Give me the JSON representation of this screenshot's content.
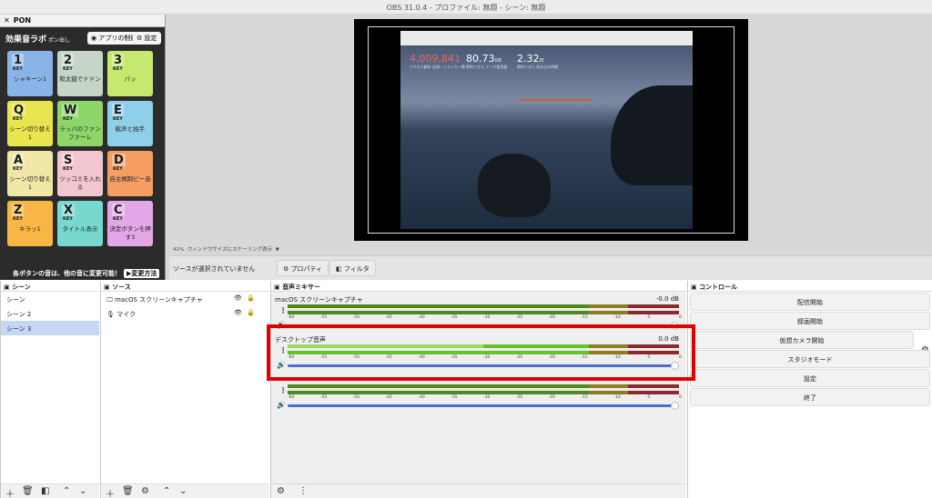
{
  "window": {
    "title": "OBS 31.0.4 - プロファイル: 無題 - シーン: 無題"
  },
  "pon": {
    "close": "✕",
    "title": "PON",
    "logo": "効果音ラボ",
    "logo_sub": "ポン出し",
    "device_button": "アプリの制御",
    "settings_button": "設定",
    "keys": [
      {
        "key": "1",
        "name": "シャキーン1",
        "color": "#8ab4e8"
      },
      {
        "key": "2",
        "name": "和太鼓でドドン",
        "color": "#c5d6c9"
      },
      {
        "key": "3",
        "name": "パッ",
        "color": "#c7e86f"
      },
      {
        "key": "Q",
        "name": "シーン切り替え1",
        "color": "#e9e54e"
      },
      {
        "key": "W",
        "name": "ラッパのファンファーレ",
        "color": "#8fd66a"
      },
      {
        "key": "E",
        "name": "歓声と拍手",
        "color": "#8fd0e8"
      },
      {
        "key": "A",
        "name": "シーン切り替え1",
        "color": "#f0e6a6"
      },
      {
        "key": "S",
        "name": "ツッコミを入れる",
        "color": "#f1c6cf"
      },
      {
        "key": "D",
        "name": "自主規制ピー音",
        "color": "#f59d62"
      },
      {
        "key": "Z",
        "name": "キラッ1",
        "color": "#f7b646"
      },
      {
        "key": "X",
        "name": "タイトル表示",
        "color": "#76d8cf"
      },
      {
        "key": "C",
        "name": "決定ボタンを押す3",
        "color": "#e3a7e7"
      }
    ],
    "key_label": "KEY",
    "footer_text": "各ボタンの音は、他の音に変更可能！",
    "footer_button": "変更方法"
  },
  "screen": {
    "stats": [
      {
        "value": "4,009,841",
        "unit": "",
        "label": "アクセス解析  記録 - トラッカー数",
        "color": "#e8685a"
      },
      {
        "value": "80.73",
        "unit": "GB",
        "label": "節約できた データ使用量",
        "color": "#ffffff"
      },
      {
        "value": "2.32",
        "unit": "日",
        "label": "節約できた 読み込み時間",
        "color": "#ffffff"
      }
    ]
  },
  "scalebar": {
    "zoom": "41%",
    "text": "ウィンドウサイズにスケーリング表示"
  },
  "toolbar": {
    "no_source": "ソースが選択されていません",
    "properties": "プロパティ",
    "filters": "フィルタ"
  },
  "scenes": {
    "title": "シーン",
    "items": [
      "シーン",
      "シーン 2",
      "シーン 3"
    ],
    "selected": 2
  },
  "sources": {
    "title": "ソース",
    "items": [
      "macOS スクリーンキャプチャ",
      "マイク"
    ]
  },
  "mixer": {
    "title": "音声ミキサー",
    "ticks": [
      "-60",
      "-55",
      "-50",
      "-45",
      "-40",
      "-35",
      "-30",
      "-25",
      "-20",
      "-15",
      "-10",
      "-5",
      "0"
    ],
    "channels": [
      {
        "name": "macOS スクリーンキャプチャ",
        "db": "-0.0 dB"
      },
      {
        "name": "デスクトップ音声",
        "db": "0.0 dB"
      },
      {
        "name": "",
        "db": ""
      }
    ]
  },
  "controls": {
    "title": "コントロール",
    "buttons": [
      "配信開始",
      "録画開始",
      "仮想カメラ開始",
      "スタジオモード",
      "設定",
      "終了"
    ]
  }
}
